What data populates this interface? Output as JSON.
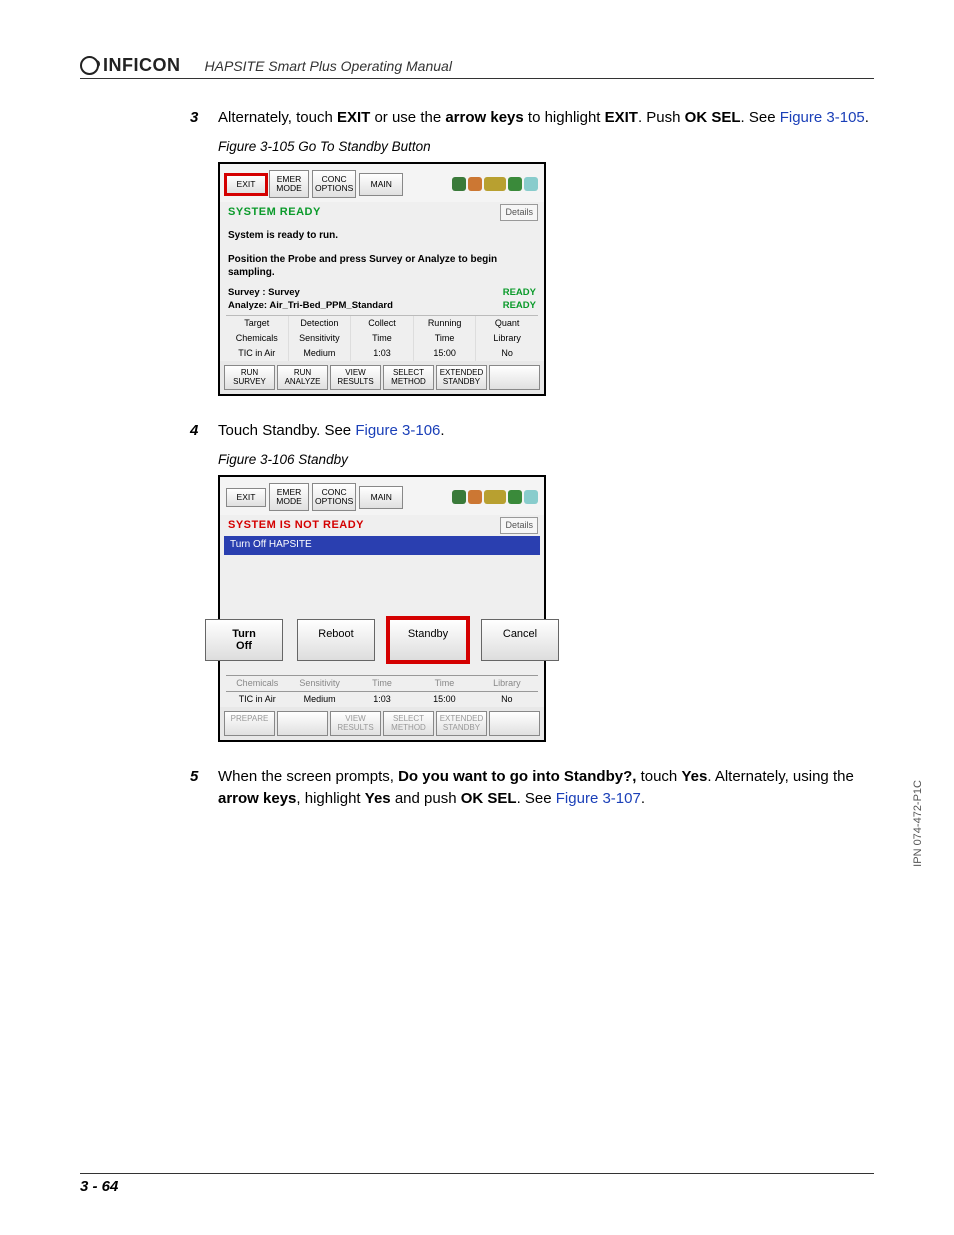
{
  "header": {
    "brand": "INFICON",
    "title": "HAPSITE Smart Plus Operating Manual"
  },
  "steps": {
    "s3": {
      "num": "3",
      "t1": "Alternately, touch ",
      "b1": "EXIT",
      "t2": " or use the ",
      "b2": "arrow keys",
      "t3": " to highlight ",
      "b3": "EXIT",
      "t4": ". Push ",
      "b4": "OK SEL",
      "t5": ". See ",
      "link": "Figure 3-105",
      "t6": "."
    },
    "s4": {
      "num": "4",
      "t1": "Touch Standby. See ",
      "link": "Figure 3-106",
      "t2": "."
    },
    "s5": {
      "num": "5",
      "t1": "When the screen prompts, ",
      "b1": "Do you want to go into Standby?,",
      "t2": " touch ",
      "b2": "Yes",
      "t3": ". Alternately, using the ",
      "b3": "arrow keys",
      "t4": ", highlight ",
      "b4": "Yes",
      "t5": " and push ",
      "b5": "OK SEL",
      "t6": ". See ",
      "link": "Figure 3-107",
      "t7": "."
    }
  },
  "figcap": {
    "f105": "Figure 3-105  Go To Standby Button",
    "f106": "Figure 3-106  Standby"
  },
  "ss1": {
    "toolbar": {
      "exit": "EXIT",
      "emer": "EMER\nMODE",
      "conc": "CONC\nOPTIONS",
      "main": "MAIN"
    },
    "status_left": "SYSTEM READY",
    "details": "Details",
    "body_l1": "System is ready to run.",
    "body_l2": "Position the Probe and press Survey or Analyze to begin sampling.",
    "survey_label": "Survey : Survey",
    "analyze_label": "Analyze: Air_Tri-Bed_PPM_Standard",
    "ready": "READY",
    "ready2": "READY",
    "table": {
      "h": [
        "Target",
        "Detection",
        "Collect",
        "Running",
        "Quant"
      ],
      "r1": [
        "Chemicals",
        "Sensitivity",
        "Time",
        "Time",
        "Library"
      ],
      "r2": [
        "TIC in Air",
        "Medium",
        "1:03",
        "15:00",
        "No"
      ]
    },
    "bottom": [
      "RUN\nSURVEY",
      "RUN\nANALYZE",
      "VIEW\nRESULTS",
      "SELECT\nMETHOD",
      "EXTENDED\nSTANDBY",
      ""
    ]
  },
  "ss2": {
    "toolbar": {
      "exit": "EXIT",
      "emer": "EMER\nMODE",
      "conc": "CONC\nOPTIONS",
      "main": "MAIN"
    },
    "status_left": "SYSTEM IS NOT READY",
    "details": "Details",
    "modal_title": "Turn Off HAPSITE",
    "modal": {
      "turnoff": "Turn\nOff",
      "reboot": "Reboot",
      "standby": "Standby",
      "cancel": "Cancel"
    },
    "partial": {
      "r0": [
        "Chemicals",
        "Sensitivity",
        "Time",
        "Time",
        "Library"
      ],
      "r1": [
        "TIC in Air",
        "Medium",
        "1:03",
        "15:00",
        "No"
      ]
    },
    "bottom": [
      "PREPARE",
      "",
      "VIEW\nRESULTS",
      "SELECT\nMETHOD",
      "EXTENDED\nSTANDBY",
      ""
    ]
  },
  "side": "IPN 074-472-P1C",
  "footer": "3 - 64"
}
